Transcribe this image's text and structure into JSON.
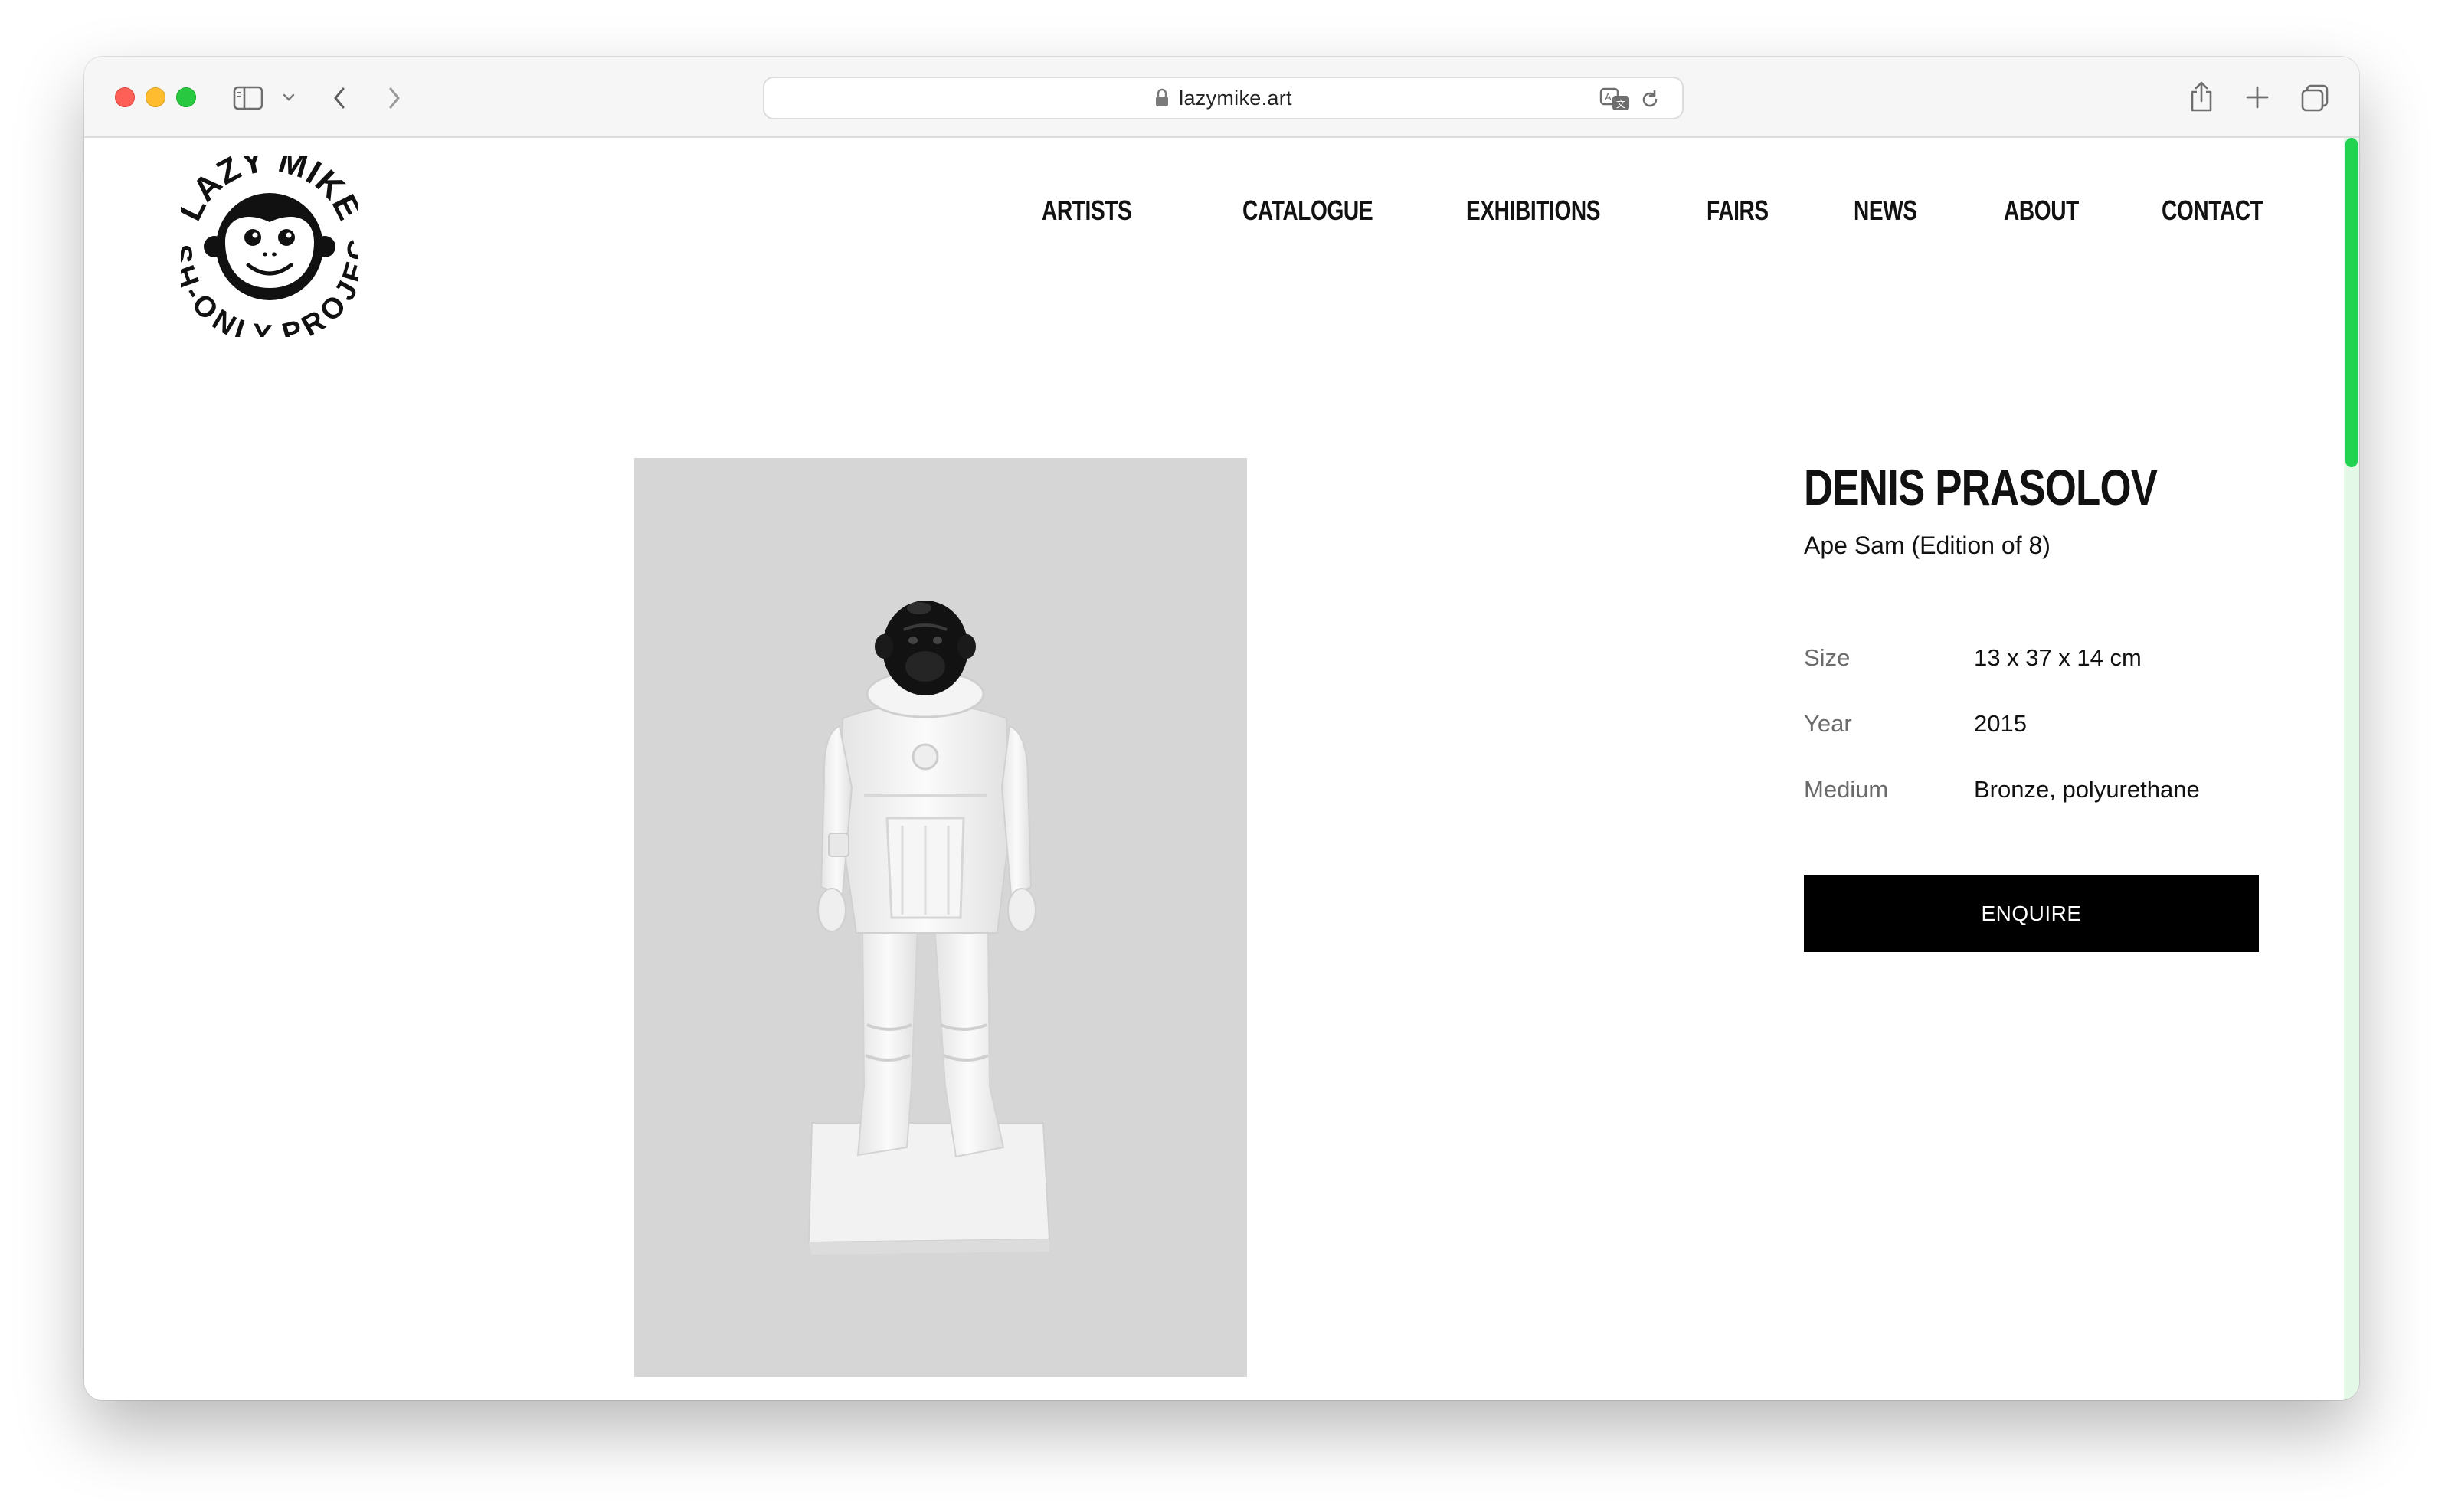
{
  "browser": {
    "url": "lazymike.art"
  },
  "logo": {
    "top_text": "LAZY MIKE",
    "bottom_text": "CASH-ONLY PROJECTS"
  },
  "nav": {
    "items": [
      {
        "label": "ARTISTS"
      },
      {
        "label": "CATALOGUE"
      },
      {
        "label": "EXHIBITIONS"
      },
      {
        "label": "FAIRS"
      },
      {
        "label": "NEWS"
      },
      {
        "label": "ABOUT"
      },
      {
        "label": "CONTACT"
      }
    ]
  },
  "artwork": {
    "artist": "DENIS PRASOLOV",
    "title": "Ape Sam (Edition of 8)",
    "details": [
      {
        "label": "Size",
        "value": "13 x 37 x 14 cm"
      },
      {
        "label": "Year",
        "value": "2015"
      },
      {
        "label": "Medium",
        "value": "Bronze, polyurethane"
      }
    ],
    "enquire_label": "ENQUIRE"
  },
  "colors": {
    "scrollbar": "#22d352",
    "artwork_bg": "#d6d6d6",
    "button_bg": "#000000"
  }
}
